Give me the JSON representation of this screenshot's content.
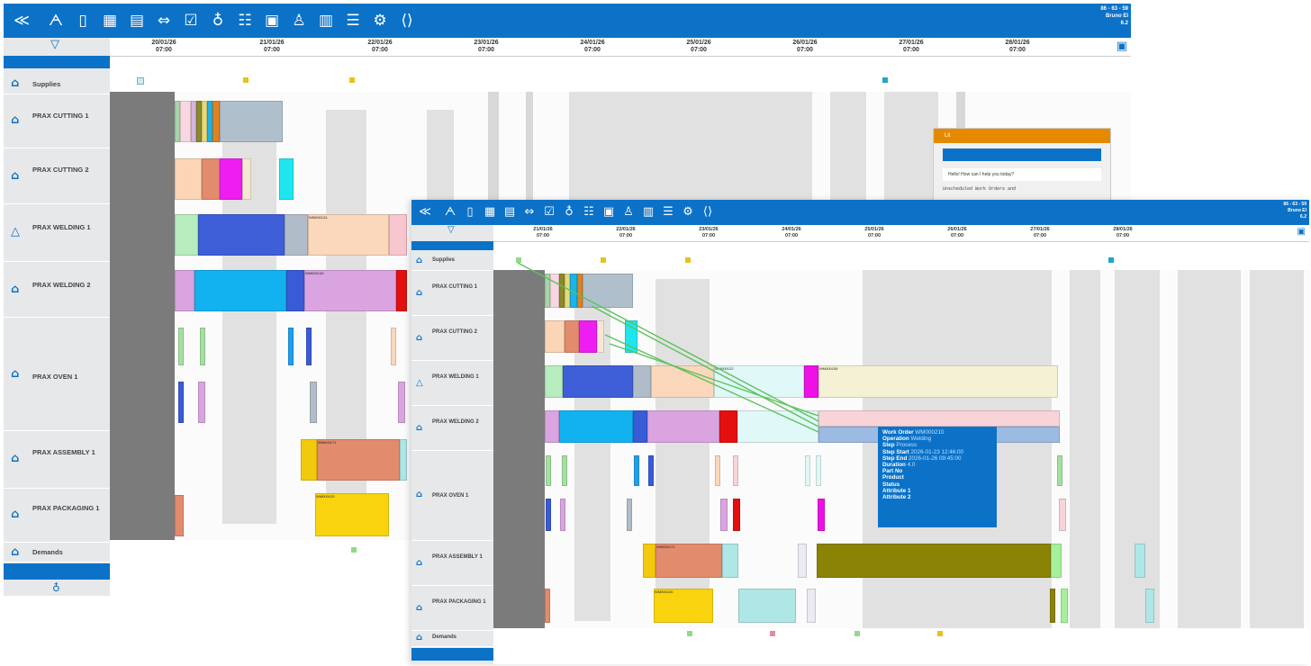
{
  "toolbar": {
    "icons": [
      "logo-icon",
      "user-icon",
      "tablet-icon",
      "calendar-icon",
      "calendar-edit-icon",
      "link-icon",
      "checklist-icon",
      "lightbulb-icon",
      "sliders-icon",
      "grid-icon",
      "tree-icon",
      "chart-icon",
      "list-icon",
      "gear-icon",
      "code-icon"
    ],
    "user_line1": "86 - 63 - 59",
    "user_line2": "Bruno El",
    "user_line3": "6.2"
  },
  "dates": [
    {
      "d": "20/01/26",
      "t": "07:00"
    },
    {
      "d": "21/01/26",
      "t": "07:00"
    },
    {
      "d": "22/01/26",
      "t": "07:00"
    },
    {
      "d": "23/01/26",
      "t": "07:00"
    },
    {
      "d": "24/01/26",
      "t": "07:00"
    },
    {
      "d": "25/01/26",
      "t": "07:00"
    },
    {
      "d": "26/01/26",
      "t": "07:00"
    },
    {
      "d": "27/01/26",
      "t": "07:00"
    },
    {
      "d": "28/01/26",
      "t": "07:00"
    }
  ],
  "resources": {
    "supplies": "Supplies",
    "cut1": "PRAX CUTTING 1",
    "cut2": "PRAX CUTTING 2",
    "weld1": "PRAX WELDING 1",
    "weld2": "PRAX WELDING 2",
    "oven": "PRAX OVEN 1",
    "assembly": "PRAX ASSEMBLY 1",
    "packaging": "PRAX PACKAGING 1",
    "demands": "Demands"
  },
  "labels": {
    "wo1": "WM000171",
    "wo2": "WM000124",
    "wo3": "WM000140",
    "wo4": "WM000120",
    "wo5": "WM000122",
    "wo6": "WM000155"
  },
  "chat": {
    "title": "Lit",
    "greeting": "Hello! How can I help you today?",
    "followup": "Unscheduled Work Orders and"
  },
  "tooltip": {
    "work_order_k": "Work Order",
    "work_order_v": "WM000210",
    "operation_k": "Operation",
    "operation_v": "Welding",
    "step_k": "Step",
    "step_v": "Process",
    "step_start_k": "Step Start",
    "step_start_v": "2026-01-23 12:46:00",
    "step_end_k": "Step End",
    "step_end_v": "2026-01-26 09:45:00",
    "duration_k": "Duration",
    "duration_v": "4.0",
    "part_k": "Part No",
    "product_k": "Product",
    "status_k": "Status",
    "attr1_k": "Attribute 1",
    "attr2_k": "Attribute 2"
  },
  "colors": {
    "toolbar": "#0b72c8",
    "link_lines": "#5cc15c",
    "tooltip_bg": "#0b72c8",
    "chat_header": "#e58a00"
  }
}
